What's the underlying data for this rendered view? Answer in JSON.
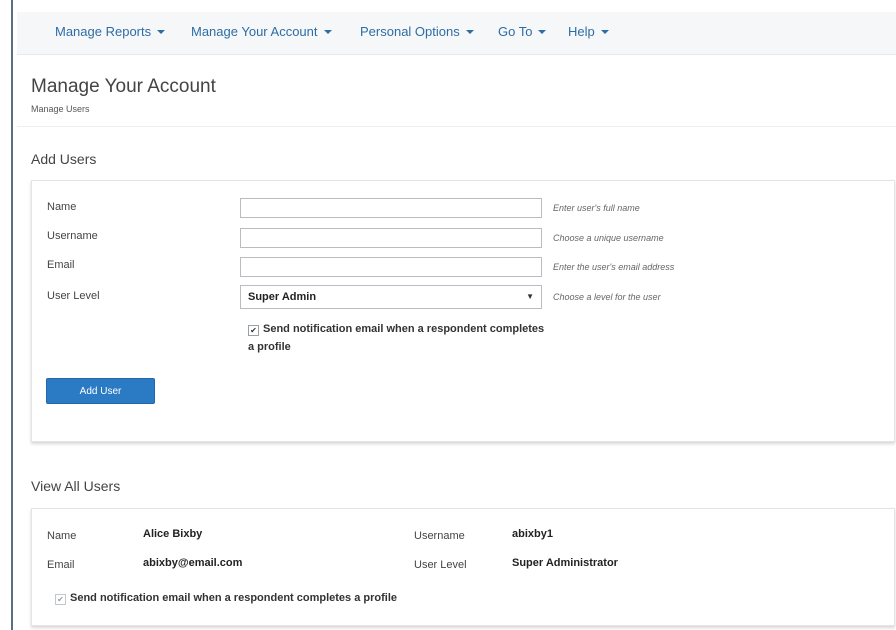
{
  "nav": {
    "items": [
      {
        "label": "Manage Reports"
      },
      {
        "label": "Manage Your Account"
      },
      {
        "label": "Personal Options"
      },
      {
        "label": "Go To"
      },
      {
        "label": "Help"
      }
    ]
  },
  "page": {
    "title": "Manage Your Account",
    "subtitle": "Manage Users"
  },
  "add_users": {
    "section_title": "Add Users",
    "fields": {
      "name": {
        "label": "Name",
        "value": "",
        "hint": "Enter user's full name"
      },
      "username": {
        "label": "Username",
        "value": "",
        "hint": "Choose a unique username"
      },
      "email": {
        "label": "Email",
        "value": "",
        "hint": "Enter the user's email address"
      },
      "user_level": {
        "label": "User Level",
        "selected": "Super Admin",
        "hint": "Choose a level for the user"
      }
    },
    "notify": {
      "checked": true,
      "label": "Send notification email when a respondent completes a profile"
    },
    "add_button": "Add User"
  },
  "view_users": {
    "section_title": "View All Users",
    "user": {
      "name_label": "Name",
      "name": "Alice Bixby",
      "username_label": "Username",
      "username": "abixby1",
      "email_label": "Email",
      "email": "abixby@email.com",
      "level_label": "User Level",
      "level": "Super Administrator",
      "notify": {
        "checked": true,
        "label": "Send notification email when a respondent completes a profile"
      }
    }
  },
  "colors": {
    "nav_link": "#2e6da4",
    "button": "#2b7bc4",
    "left_bar": "#5c6e82"
  }
}
